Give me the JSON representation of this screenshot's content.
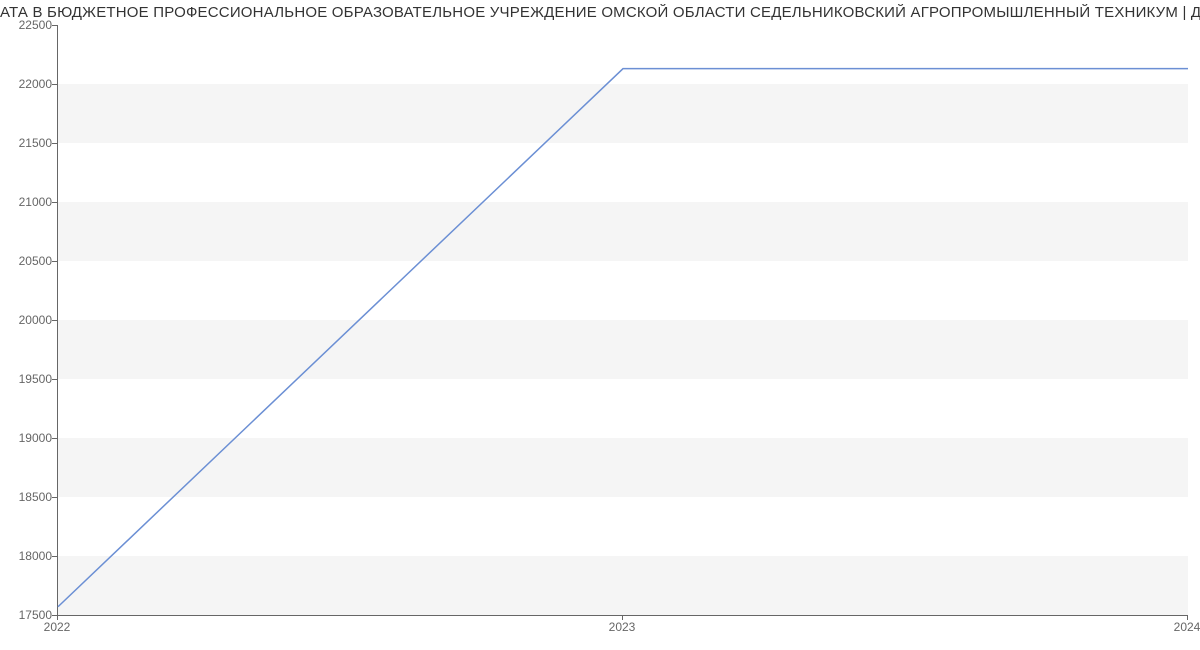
{
  "chart_data": {
    "type": "line",
    "title": "АТА В БЮДЖЕТНОЕ ПРОФЕССИОНАЛЬНОЕ ОБРАЗОВАТЕЛЬНОЕ УЧРЕЖДЕНИЕ ОМСКОЙ ОБЛАСТИ СЕДЕЛЬНИКОВСКИЙ АГРОПРОМЫШЛЕННЫЙ ТЕХНИКУМ | Данные mnogo",
    "xlabel": "",
    "ylabel": "",
    "x": [
      2022,
      2023,
      2024
    ],
    "values": [
      17570,
      22130,
      22130
    ],
    "ylim": [
      17500,
      22500
    ],
    "y_ticks": [
      17500,
      18000,
      18500,
      19000,
      19500,
      20000,
      20500,
      21000,
      21500,
      22000,
      22500
    ],
    "x_ticks": [
      2022,
      2023,
      2024
    ],
    "line_color": "#6b8fd4",
    "grid": true
  }
}
